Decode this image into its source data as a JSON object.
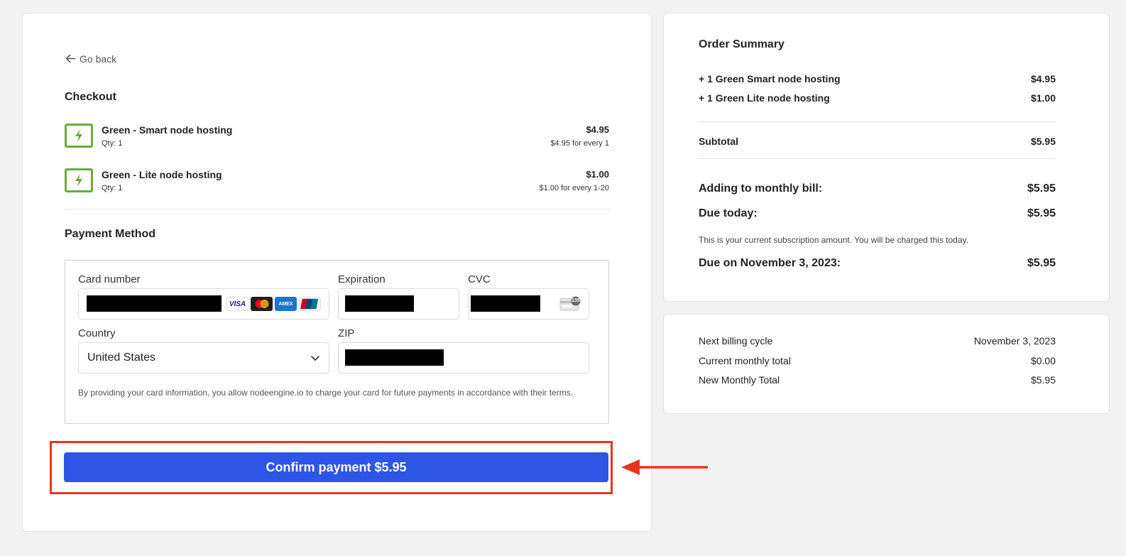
{
  "nav": {
    "go_back": "Go back"
  },
  "checkout": {
    "title": "Checkout",
    "items": [
      {
        "name": "Green - Smart node hosting",
        "qty": "Qty: 1",
        "price": "$4.95",
        "rate": "$4.95 for every 1",
        "icon": "bolt-icon"
      },
      {
        "name": "Green - Lite node hosting",
        "qty": "Qty: 1",
        "price": "$1.00",
        "rate": "$1.00 for every 1-20",
        "icon": "bolt-icon"
      }
    ]
  },
  "payment": {
    "title": "Payment Method",
    "card_number_label": "Card number",
    "expiration_label": "Expiration",
    "cvc_label": "CVC",
    "country_label": "Country",
    "country_value": "United States",
    "zip_label": "ZIP",
    "card_brands": [
      "VISA",
      "Mastercard",
      "AMEX",
      "UnionPay"
    ],
    "cvc_badge": "135",
    "terms": "By providing your card information, you allow nodeengine.io to charge your card for future payments in accordance with their terms."
  },
  "confirm_button": "Confirm payment $5.95",
  "summary": {
    "title": "Order Summary",
    "items": [
      {
        "label": "+ 1 Green Smart node hosting",
        "amount": "$4.95"
      },
      {
        "label": "+ 1 Green Lite node hosting",
        "amount": "$1.00"
      }
    ],
    "subtotal_label": "Subtotal",
    "subtotal_amount": "$5.95",
    "monthly_label": "Adding to monthly bill:",
    "monthly_amount": "$5.95",
    "due_today_label": "Due today:",
    "due_today_amount": "$5.95",
    "note": "This is your current subscription amount. You will be charged this today.",
    "due_on_label": "Due on November 3, 2023:",
    "due_on_amount": "$5.95"
  },
  "billing": {
    "rows": [
      {
        "label": "Next billing cycle",
        "value": "November 3, 2023"
      },
      {
        "label": "Current monthly total",
        "value": "$0.00"
      },
      {
        "label": "New Monthly Total",
        "value": "$5.95"
      }
    ]
  },
  "colors": {
    "accent_button": "#2d55e6",
    "bolt_green": "#6aab3a",
    "annotation_red": "#e8341c"
  }
}
